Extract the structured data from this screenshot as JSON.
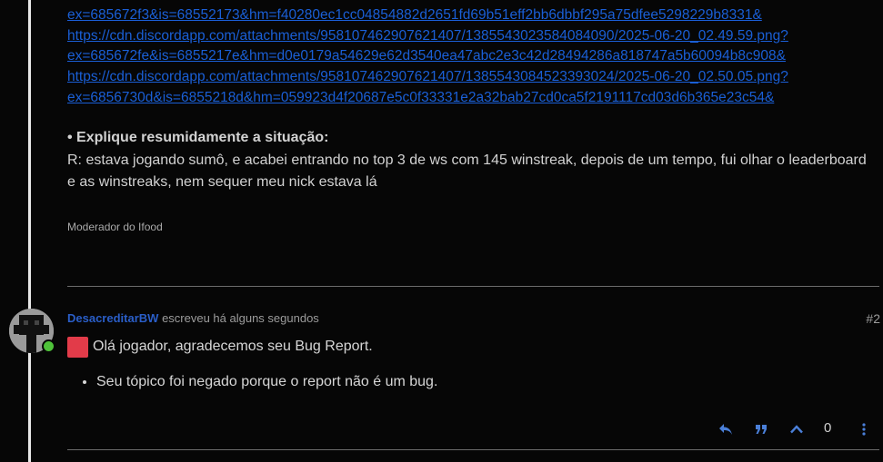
{
  "links": [
    "ex=685672f3&is=68552173&hm=f40280ec1cc04854882d2651fd69b51eff2bb6dbbf295a75dfee5298229b8331&",
    "https://cdn.discordapp.com/attachments/958107462907621407/1385543023584084090/2025-06-20_02.49.59.png?",
    "ex=685672fe&is=6855217e&hm=d0e0179a54629e62d3540ea47abc2e3c42d28494286a818747a5b60094b8c908&",
    "https://cdn.discordapp.com/attachments/958107462907621407/1385543084523393024/2025-06-20_02.50.05.png?",
    "ex=6856730d&is=6855218d&hm=059923d4f20687e5c0f33331e2a32bab27cd0ca5f2191117cd03d6b365e23c54&"
  ],
  "situation": {
    "heading": "• Explique resumidamente a situação:",
    "answer": "R: estava jogando sumô, e acabei entrando no top 3 de ws com 145 winstreak, depois de um tempo, fui olhar o leaderboard e as winstreaks, nem sequer meu nick estava lá"
  },
  "signature": "Moderador do Ifood",
  "reply": {
    "author": "DesacreditarBW",
    "meta": "escreveu há alguns segundos",
    "number": "#2",
    "greeting": "Olá jogador, agradecemos seu Bug Report.",
    "bullets": [
      "Seu tópico foi negado porque o report não é um bug."
    ],
    "like_count": "0"
  },
  "icons": {
    "reply": "reply-icon",
    "quote": "quote-icon",
    "upvote": "chevron-up-icon",
    "more": "more-vertical-icon"
  },
  "colors": {
    "background": "#060606",
    "link": "#1a5fd6",
    "author": "#2a5ec8",
    "accent_red": "#e23b49",
    "online": "#4fc23a"
  }
}
